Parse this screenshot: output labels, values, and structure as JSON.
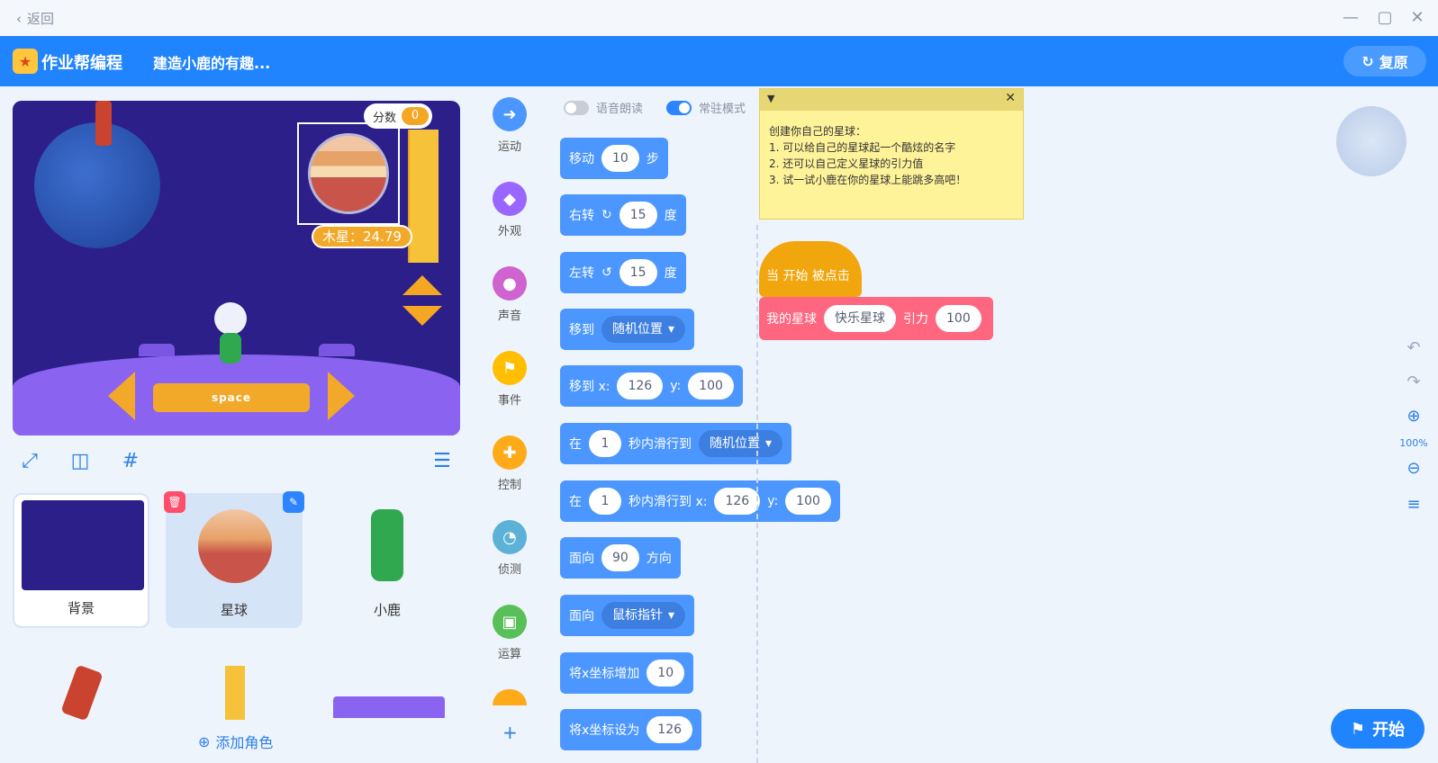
{
  "titlebar": {
    "back": "返回",
    "min": "—",
    "max": "▢",
    "close": "✕"
  },
  "header": {
    "app": "作业帮编程",
    "project": "建造小鹿的有趣...",
    "restore": "复原"
  },
  "stage": {
    "score_label": "分数",
    "score": "0",
    "jupiter": "木星：24.79",
    "space": "space"
  },
  "sprites": [
    {
      "name": "背景"
    },
    {
      "name": "星球"
    },
    {
      "name": "小鹿"
    }
  ],
  "add_role": "添加角色",
  "categories": [
    {
      "name": "运动",
      "color": "#4c97ff",
      "icon": "motion-icon"
    },
    {
      "name": "外观",
      "color": "#9966ff",
      "icon": "looks-icon"
    },
    {
      "name": "声音",
      "color": "#cf63cf",
      "icon": "sound-icon"
    },
    {
      "name": "事件",
      "color": "#ffbf00",
      "icon": "events-icon"
    },
    {
      "name": "控制",
      "color": "#ffab19",
      "icon": "control-icon"
    },
    {
      "name": "侦测",
      "color": "#5cb1d6",
      "icon": "sensing-icon"
    },
    {
      "name": "运算",
      "color": "#59c059",
      "icon": "operators-icon"
    }
  ],
  "toggles": {
    "read": "语音朗读",
    "mode": "常驻模式"
  },
  "blocks": {
    "move": {
      "a": "移动",
      "v": "10",
      "b": "步"
    },
    "turn_r": {
      "a": "右转",
      "v": "15",
      "b": "度"
    },
    "turn_l": {
      "a": "左转",
      "v": "15",
      "b": "度"
    },
    "goto": {
      "a": "移到",
      "d": "随机位置"
    },
    "gotoxy": {
      "a": "移到 x:",
      "x": "126",
      "y_label": "y:",
      "y": "100"
    },
    "glide": {
      "a": "在",
      "v": "1",
      "b": "秒内滑行到",
      "d": "随机位置"
    },
    "glidexy": {
      "a": "在",
      "v": "1",
      "b": "秒内滑行到 x:",
      "x": "126",
      "y_label": "y:",
      "y": "100"
    },
    "point": {
      "a": "面向",
      "v": "90",
      "b": "方向"
    },
    "pointto": {
      "a": "面向",
      "d": "鼠标指针"
    },
    "changex": {
      "a": "将x坐标增加",
      "v": "10"
    },
    "setx": {
      "a": "将x坐标设为",
      "v": "126"
    }
  },
  "note": {
    "l1": "创建你自己的星球：",
    "l2": "1. 可以给自己的星球起一个酷炫的名字",
    "l3": "2. 还可以自己定义星球的引力值",
    "l4": "3. 试一试小鹿在你的星球上能跳多高吧！"
  },
  "script": {
    "hat": "当 开始 被点击",
    "a": "我的星球",
    "name": "快乐星球",
    "b": "引力",
    "v": "100"
  },
  "zoom": "100%",
  "start": "开始"
}
